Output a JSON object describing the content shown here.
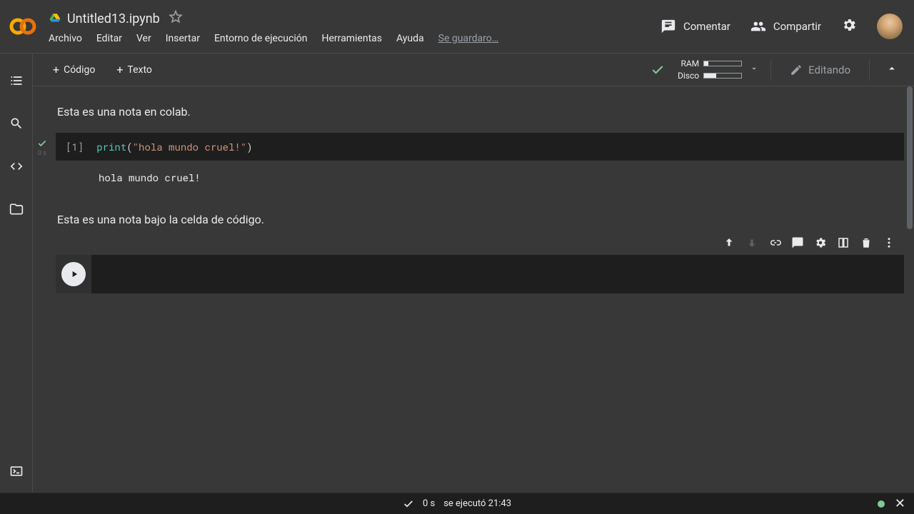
{
  "header": {
    "filename": "Untitled13.ipynb",
    "menu": {
      "file": "Archivo",
      "edit": "Editar",
      "view": "Ver",
      "insert": "Insertar",
      "runtime": "Entorno de ejecución",
      "tools": "Herramientas",
      "help": "Ayuda",
      "save_status": "Se guardaro…"
    },
    "actions": {
      "comment": "Comentar",
      "share": "Compartir"
    }
  },
  "toolbar": {
    "add_code": "Código",
    "add_text": "Texto",
    "ram_label": "RAM",
    "disk_label": "Disco",
    "edit_label": "Editando"
  },
  "cells": {
    "text1": "Esta es una nota en colab.",
    "code1_exec": "[1]",
    "code1_timing": "0 s",
    "code1_fn": "print",
    "code1_paren_open": "(",
    "code1_str": "\"hola mundo cruel!\"",
    "code1_paren_close": ")",
    "code1_output": "hola mundo cruel!",
    "text2": "Esta es una nota bajo la celda de código."
  },
  "statusbar": {
    "duration": "0 s",
    "executed": "se ejecutó 21:43"
  }
}
